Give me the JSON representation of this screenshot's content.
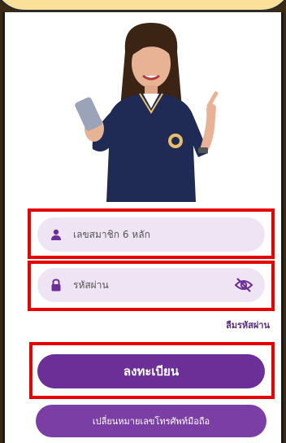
{
  "login": {
    "member_id_placeholder": "เลขสมาชิก 6 หลัก",
    "password_placeholder": "รหัสผ่าน",
    "forgot_password": "ลืมรหัสผ่าน",
    "register_button": "ลงทะเบียน",
    "change_phone_button": "เปลี่ยนหมายเลขโทรศัพท์มือถือ"
  },
  "icons": {
    "user": "user-icon",
    "lock": "lock-icon",
    "eye_off": "eye-off-icon"
  },
  "colors": {
    "primary": "#6c2f97",
    "field_bg": "#efe4f4",
    "highlight": "#e60000"
  }
}
